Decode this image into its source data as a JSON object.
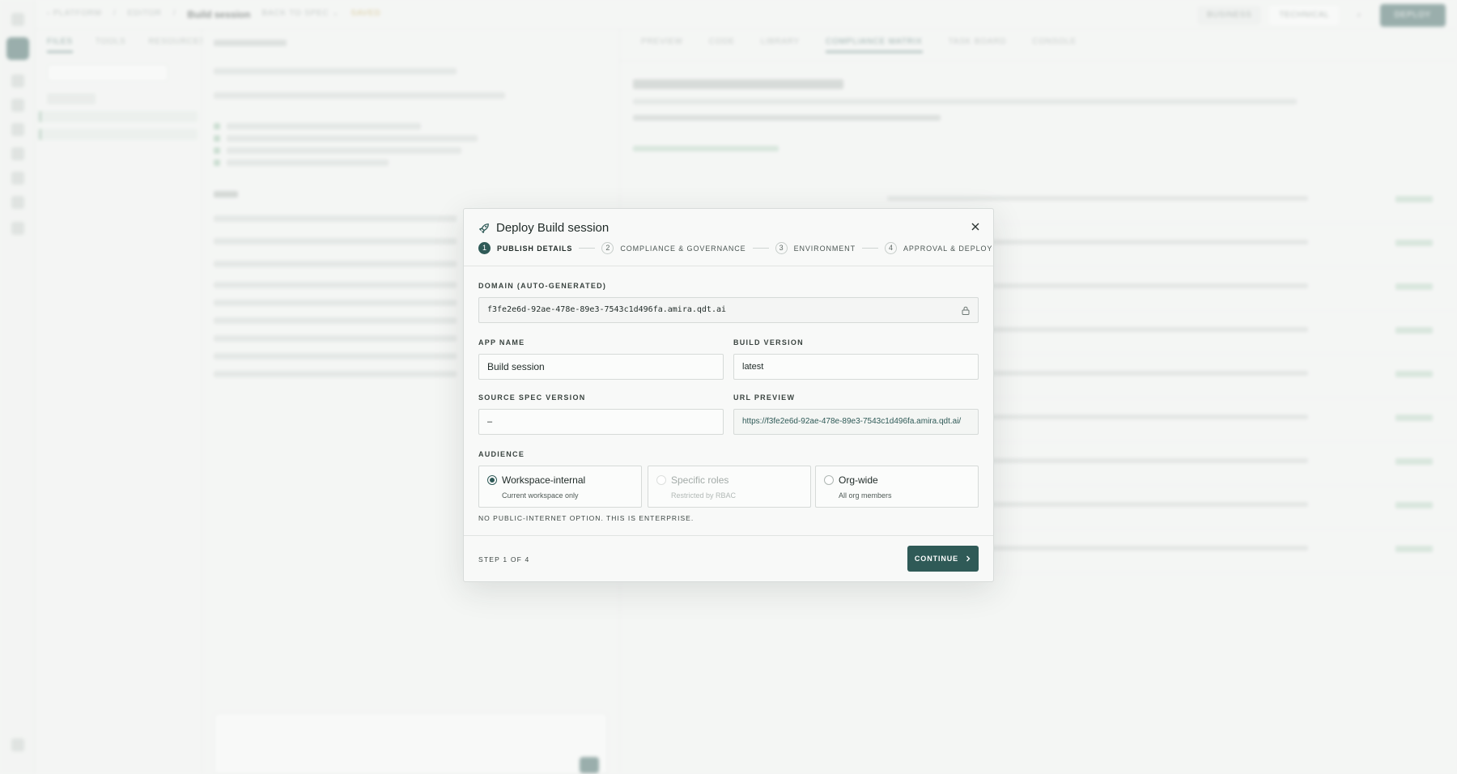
{
  "modal": {
    "title": "Deploy Build session",
    "steps": [
      {
        "num": "1",
        "label": "Publish details"
      },
      {
        "num": "2",
        "label": "Compliance & governance"
      },
      {
        "num": "3",
        "label": "Environment"
      },
      {
        "num": "4",
        "label": "Approval & deploy"
      }
    ],
    "domain": {
      "label": "DOMAIN (AUTO-GENERATED)",
      "value": "f3fe2e6d-92ae-478e-89e3-7543c1d496fa.amira.qdt.ai"
    },
    "app_name": {
      "label": "APP NAME",
      "value": "Build session"
    },
    "build_version": {
      "label": "BUILD VERSION",
      "value": "latest"
    },
    "source_spec": {
      "label": "SOURCE SPEC VERSION",
      "value": "–"
    },
    "url_preview": {
      "label": "URL PREVIEW",
      "value": "https://f3fe2e6d-92ae-478e-89e3-7543c1d496fa.amira.qdt.ai/"
    },
    "audience": {
      "label": "AUDIENCE",
      "options": [
        {
          "title": "Workspace-internal",
          "desc": "Current workspace only",
          "selected": true,
          "disabled": false
        },
        {
          "title": "Specific roles",
          "desc": "Restricted by RBAC",
          "selected": false,
          "disabled": true
        },
        {
          "title": "Org-wide",
          "desc": "All org members",
          "selected": false,
          "disabled": false
        }
      ]
    },
    "note": "NO PUBLIC-INTERNET OPTION. THIS IS ENTERPRISE.",
    "step_of": "STEP 1 OF 4",
    "continue_label": "CONTINUE"
  },
  "colors": {
    "accent": "#2f5a57"
  }
}
